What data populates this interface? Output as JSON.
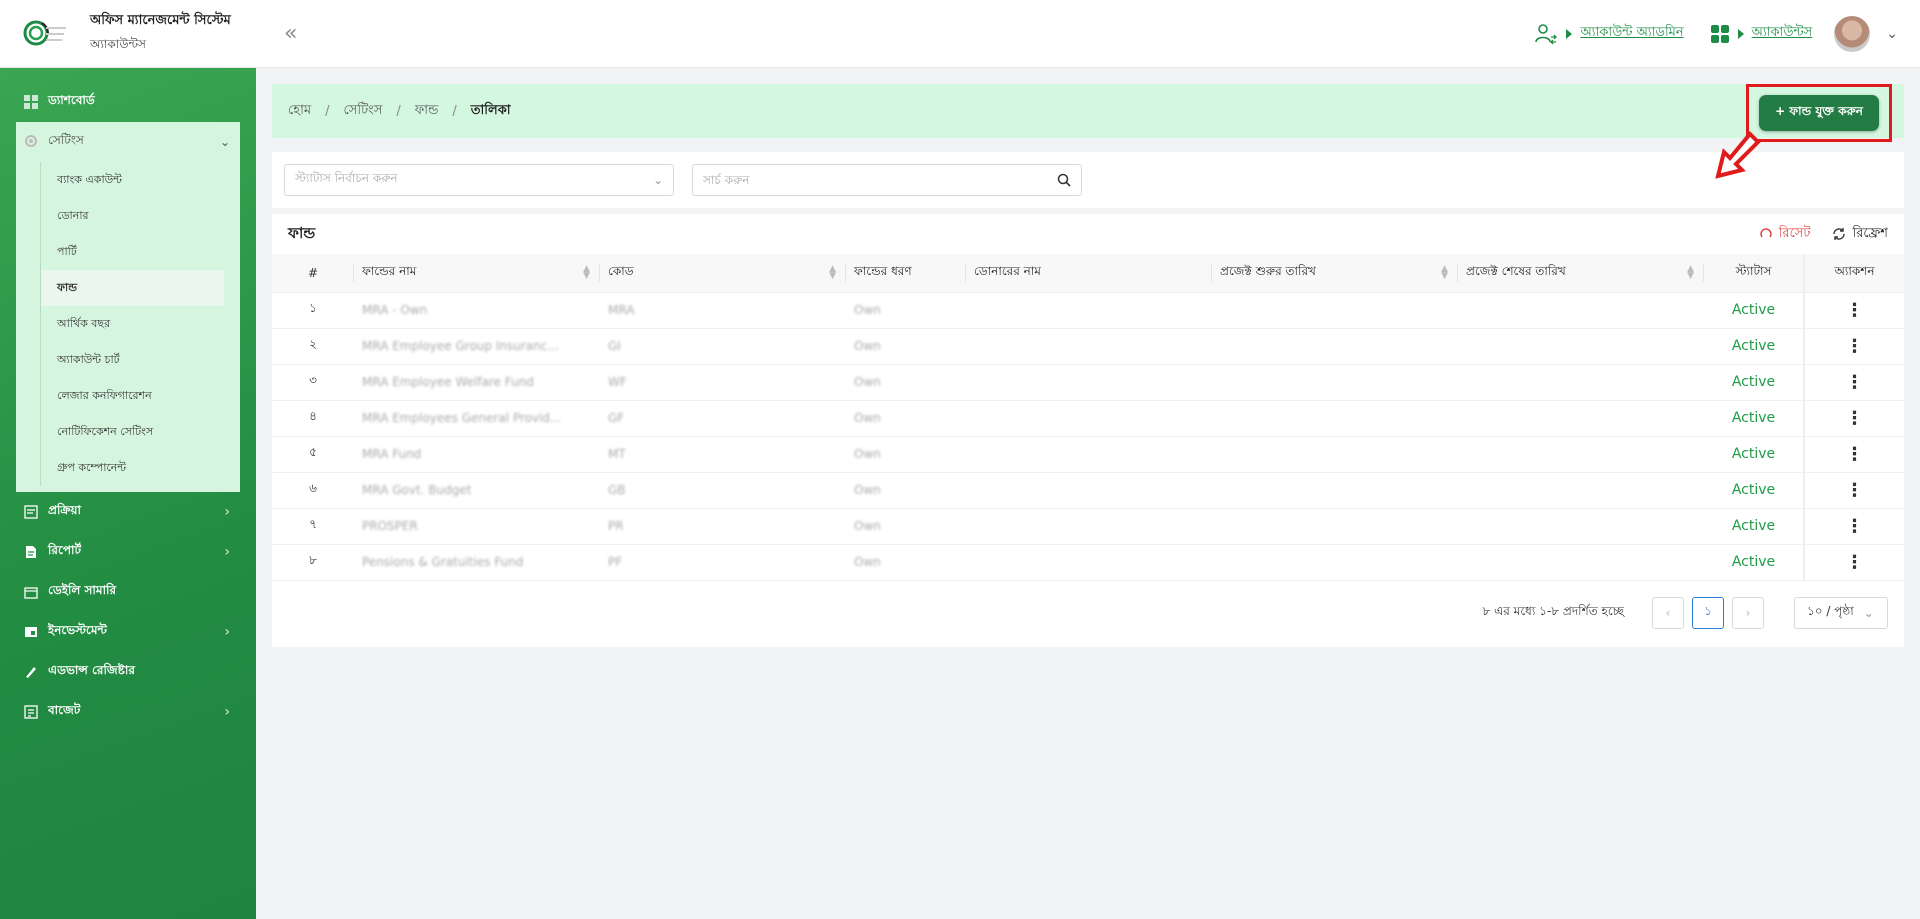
{
  "header": {
    "title": "অফিস ম্যানেজমেন্ট সিস্টেম",
    "subtitle": "অ্যাকাউন্টস",
    "collapse_icon": "double-chevron-left-icon",
    "account_admin": "অ্যাকাউন্ট অ্যাডমিন",
    "accounts": "অ্যাকাউন্টস"
  },
  "sidebar": {
    "items": [
      {
        "label": "ড্যাশবোর্ড",
        "icon": "dashboard-icon"
      },
      {
        "label": "প্রক্রিয়া",
        "icon": "process-icon"
      },
      {
        "label": "রিপোর্ট",
        "icon": "report-icon"
      },
      {
        "label": "ডেইলি সামারি",
        "icon": "daily-summary-icon"
      },
      {
        "label": "ইনভেস্টমেন্ট",
        "icon": "investment-icon"
      },
      {
        "label": "এডভান্স রেজিষ্টার",
        "icon": "advance-register-icon"
      },
      {
        "label": "বাজেট",
        "icon": "budget-icon"
      }
    ],
    "settings": {
      "label": "সেটিংস",
      "sub": [
        "ব্যাংক একাউন্ট",
        "ডোনার",
        "পার্টি",
        "ফান্ড",
        "আর্থিক বছর",
        "অ্যাকাউন্ট চার্ট",
        "লেজার কনফিগারেশন",
        "নোটিফিকেশন সেটিংস",
        "গ্রুপ কম্পোনেন্ট"
      ]
    }
  },
  "breadcrumb": [
    "হোম",
    "সেটিংস",
    "ফান্ড",
    "তালিকা"
  ],
  "add_button": "+ ফান্ড যুক্ত করুন",
  "filters": {
    "status_placeholder": "স্ট্যাটাস নির্বাচন করুন",
    "search_placeholder": "সার্চ করুন"
  },
  "table": {
    "title": "ফান্ড",
    "reset": "রিসেট",
    "refresh": "রিফ্রেশ",
    "columns": [
      "#",
      "ফান্ডের নাম",
      "কোড",
      "ফান্ডের ধরণ",
      "ডোনারের নাম",
      "প্রজেক্ট শুরুর তারিখ",
      "প্রজেক্ট শেষের তারিখ",
      "স্ট্যাটাস",
      "অ্যাকশন"
    ],
    "rows": [
      {
        "n": "১",
        "name": "MRA - Own",
        "code": "MRA",
        "type": "Own",
        "status": "Active"
      },
      {
        "n": "২",
        "name": "MRA Employee Group Insuranc...",
        "code": "GI",
        "type": "Own",
        "status": "Active"
      },
      {
        "n": "৩",
        "name": "MRA Employee Welfare Fund",
        "code": "WF",
        "type": "Own",
        "status": "Active"
      },
      {
        "n": "৪",
        "name": "MRA Employees General Provid...",
        "code": "GF",
        "type": "Own",
        "status": "Active"
      },
      {
        "n": "৫",
        "name": "MRA Fund",
        "code": "MT",
        "type": "Own",
        "status": "Active"
      },
      {
        "n": "৬",
        "name": "MRA Govt. Budget",
        "code": "GB",
        "type": "Own",
        "status": "Active"
      },
      {
        "n": "৭",
        "name": "PROSPER",
        "code": "PR",
        "type": "Own",
        "status": "Active"
      },
      {
        "n": "৮",
        "name": "Pensions & Gratuities Fund",
        "code": "PF",
        "type": "Own",
        "status": "Active"
      }
    ]
  },
  "pagination": {
    "summary": "৮ এর মধ্যে ১-৮ প্রদর্শিত হচ্ছে",
    "current": "১",
    "per_page": "১০ / পৃষ্ঠা"
  },
  "colors": {
    "brand": "#237c43",
    "accent_text": "#1e8c45",
    "status_active": "#1e9c47",
    "highlight": "#e01b1b"
  }
}
